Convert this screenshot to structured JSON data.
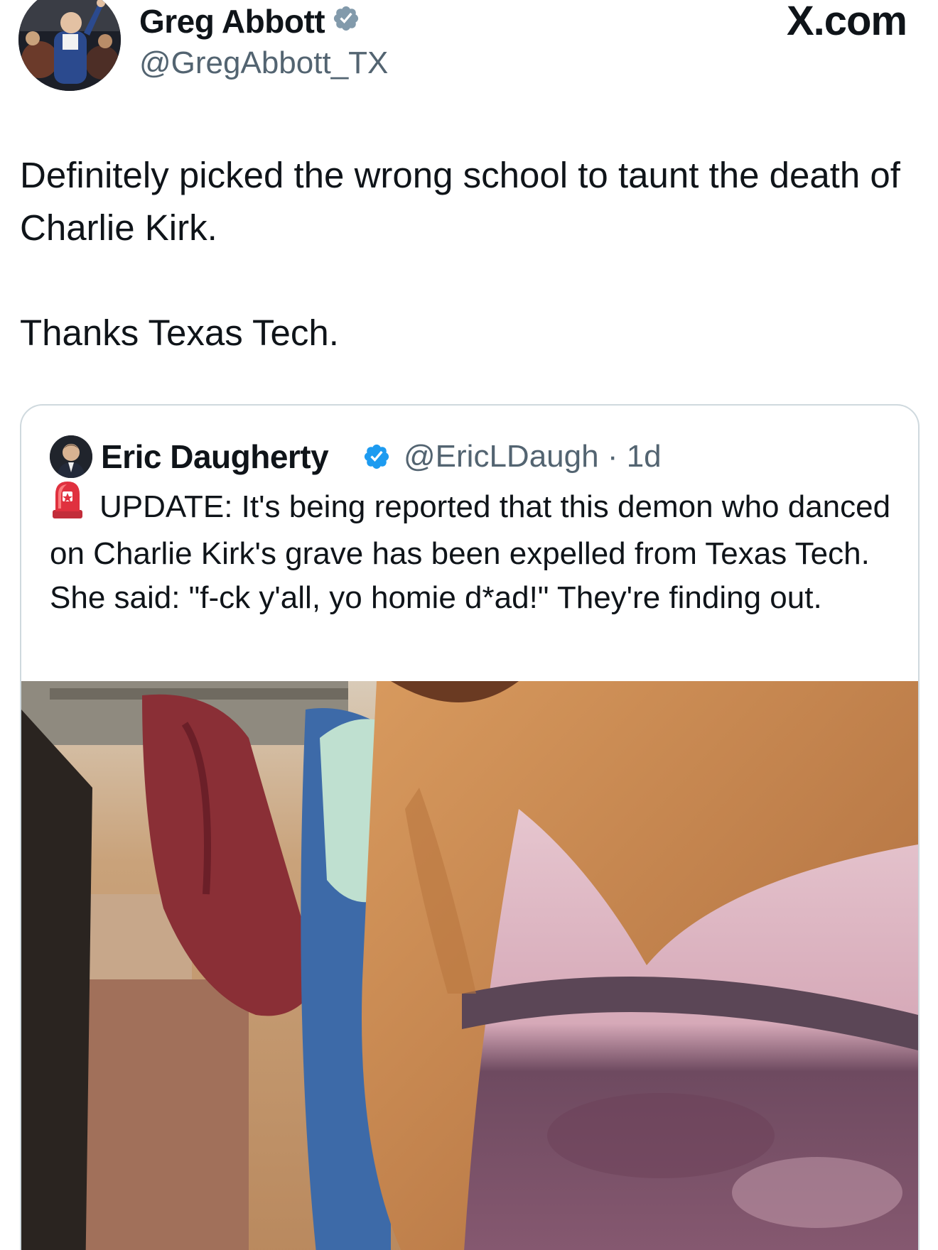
{
  "author": {
    "display_name": "Greg Abbott",
    "handle": "@GregAbbott_TX",
    "verified": true
  },
  "site": {
    "logo_text": "X.com"
  },
  "tweet": {
    "line1": "Definitely picked the wrong school to taunt the death of Charlie Kirk.",
    "line2": "Thanks Texas Tech."
  },
  "quoted_tweet": {
    "display_name": "Eric Daugherty",
    "handle": "@EricLDaugh",
    "separator": "·",
    "age": "1d",
    "text": "UPDATE: It's being reported that this demon who danced on Charlie Kirk's grave has been expelled from Texas Tech. She said: \"f-ck y'all, yo homie d*ad!\" They're finding out.",
    "lead_icon": "rotating-light-icon"
  },
  "colors": {
    "text": "#0f1419",
    "secondary": "#536471",
    "verified_blue": "#1d9bf0",
    "verified_gray": "#829aab",
    "border": "#cfd9de"
  }
}
